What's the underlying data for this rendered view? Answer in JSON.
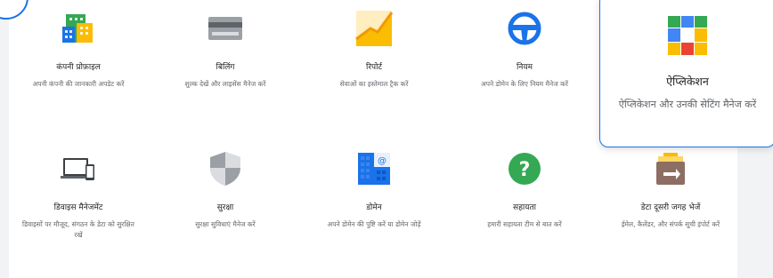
{
  "tiles": [
    {
      "title": "कंपनी प्रोफ़ाइल",
      "desc": "अपनी कंपनी की जानकारी अपडेट करें",
      "icon": "building-icon"
    },
    {
      "title": "बिलिंग",
      "desc": "शुल्क देखें और लाइसेंस मैनेज करें",
      "icon": "credit-card-icon"
    },
    {
      "title": "रिपोर्ट",
      "desc": "सेवाओं का इस्तेमाल ट्रैक करें",
      "icon": "chart-icon"
    },
    {
      "title": "नियम",
      "desc": "अपने डोमेन के लिए नियम मैनेज करें",
      "icon": "steering-wheel-icon"
    },
    {
      "title": "ऐप्लिकेशन",
      "desc": "ऐप्लिकेशन और उनकी सेटिंग मैनेज करें",
      "icon": "apps-grid-icon"
    },
    {
      "title": "डिवाइस मैनेजमेंट",
      "desc": "डिवाइसों पर मौजूद, संगठन के डेटा को सुरक्षित रखें",
      "icon": "devices-icon"
    },
    {
      "title": "सुरक्षा",
      "desc": "सुरक्षा सुविधाएं मैनेज करें",
      "icon": "shield-icon"
    },
    {
      "title": "डोमेन",
      "desc": "अपने डोमेन की पुष्टि करें या डोमेन जोड़ें",
      "icon": "domain-icon"
    },
    {
      "title": "सहायता",
      "desc": "हमारी सहायता टीम से बात करें",
      "icon": "help-icon"
    },
    {
      "title": "डेटा दूसरी जगह भेजें",
      "desc": "ईमेल, कैलेंडर, और संपर्क सूची इंपोर्ट करें",
      "icon": "data-migration-icon"
    }
  ]
}
